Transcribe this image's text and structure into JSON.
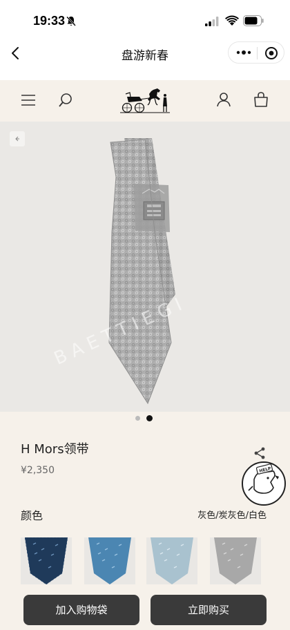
{
  "status_bar": {
    "time": "19:33"
  },
  "mini_program": {
    "title": "盘游新春"
  },
  "product": {
    "name": "H Mors领带",
    "price": "¥2,350",
    "watermark": "BAETTIEGI",
    "color_label": "颜色",
    "color_values": "灰色/炭灰色/白色",
    "help_label": "HELP",
    "carousel": {
      "total": 2,
      "active_index": 1
    },
    "swatch_colors": [
      "#1f3a5a",
      "#4b86b2",
      "#a9c2cf",
      "#a8a8a8"
    ]
  },
  "actions": {
    "add_to_cart": "加入购物袋",
    "buy_now": "立即购买"
  },
  "colors": {
    "background": "#f6f1ea",
    "button": "#3a3a3a",
    "image_background": "#eae8e5"
  },
  "icons": [
    "bell-slash-icon",
    "signal-icon",
    "wifi-icon",
    "battery-icon",
    "back-icon",
    "more-icon",
    "close-target-icon",
    "menu-icon",
    "search-icon",
    "user-icon",
    "bag-icon",
    "share-icon"
  ]
}
